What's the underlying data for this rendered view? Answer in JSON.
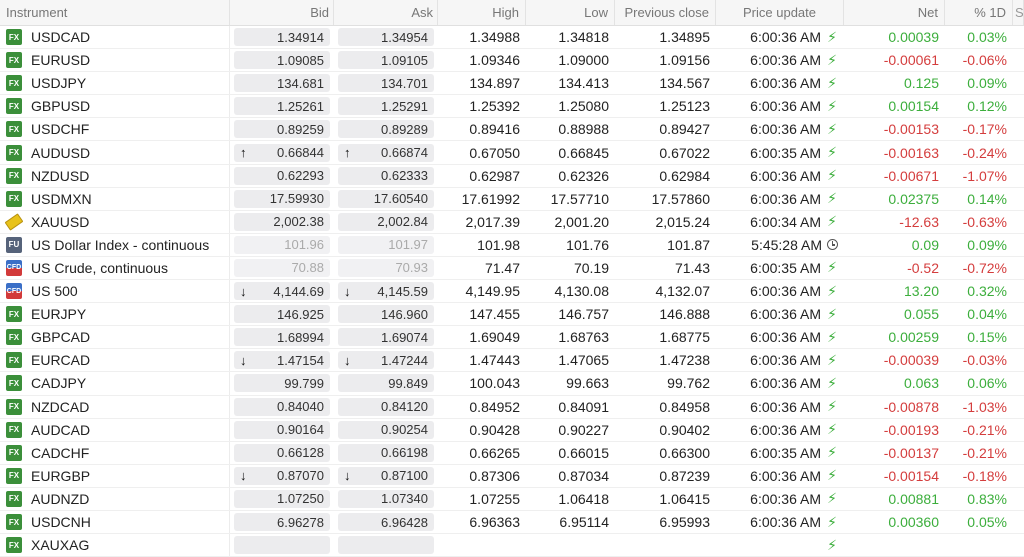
{
  "headers": {
    "instrument": "Instrument",
    "bid": "Bid",
    "ask": "Ask",
    "high": "High",
    "low": "Low",
    "previous_close": "Previous close",
    "price_update": "Price update",
    "net": "Net",
    "pct_1d": "% 1D",
    "extra": "S"
  },
  "colors": {
    "positive": "#3cae3c",
    "negative": "#d43d3d",
    "fx_badge": "#3b8f3a"
  },
  "rows": [
    {
      "badge": "FX",
      "name": "USDCAD",
      "bid": "1.34914",
      "ask": "1.34954",
      "high": "1.34988",
      "low": "1.34818",
      "prev": "1.34895",
      "time": "6:00:36 AM",
      "status": "lightning-icon",
      "net": "0.00039",
      "pct": "0.03%",
      "sign": "pos",
      "arrow": "",
      "dim": false
    },
    {
      "badge": "FX",
      "name": "EURUSD",
      "bid": "1.09085",
      "ask": "1.09105",
      "high": "1.09346",
      "low": "1.09000",
      "prev": "1.09156",
      "time": "6:00:36 AM",
      "status": "lightning-icon",
      "net": "-0.00061",
      "pct": "-0.06%",
      "sign": "neg",
      "arrow": "",
      "dim": false
    },
    {
      "badge": "FX",
      "name": "USDJPY",
      "bid": "134.681",
      "ask": "134.701",
      "high": "134.897",
      "low": "134.413",
      "prev": "134.567",
      "time": "6:00:36 AM",
      "status": "lightning-icon",
      "net": "0.125",
      "pct": "0.09%",
      "sign": "pos",
      "arrow": "",
      "dim": false
    },
    {
      "badge": "FX",
      "name": "GBPUSD",
      "bid": "1.25261",
      "ask": "1.25291",
      "high": "1.25392",
      "low": "1.25080",
      "prev": "1.25123",
      "time": "6:00:36 AM",
      "status": "lightning-icon",
      "net": "0.00154",
      "pct": "0.12%",
      "sign": "pos",
      "arrow": "",
      "dim": false
    },
    {
      "badge": "FX",
      "name": "USDCHF",
      "bid": "0.89259",
      "ask": "0.89289",
      "high": "0.89416",
      "low": "0.88988",
      "prev": "0.89427",
      "time": "6:00:36 AM",
      "status": "lightning-icon",
      "net": "-0.00153",
      "pct": "-0.17%",
      "sign": "neg",
      "arrow": "",
      "dim": false
    },
    {
      "badge": "FX",
      "name": "AUDUSD",
      "bid": "0.66844",
      "ask": "0.66874",
      "high": "0.67050",
      "low": "0.66845",
      "prev": "0.67022",
      "time": "6:00:35 AM",
      "status": "lightning-icon",
      "net": "-0.00163",
      "pct": "-0.24%",
      "sign": "neg",
      "arrow": "up",
      "dim": false
    },
    {
      "badge": "FX",
      "name": "NZDUSD",
      "bid": "0.62293",
      "ask": "0.62333",
      "high": "0.62987",
      "low": "0.62326",
      "prev": "0.62984",
      "time": "6:00:36 AM",
      "status": "lightning-icon",
      "net": "-0.00671",
      "pct": "-1.07%",
      "sign": "neg",
      "arrow": "",
      "dim": false
    },
    {
      "badge": "FX",
      "name": "USDMXN",
      "bid": "17.59930",
      "ask": "17.60540",
      "high": "17.61992",
      "low": "17.57710",
      "prev": "17.57860",
      "time": "6:00:36 AM",
      "status": "lightning-icon",
      "net": "0.02375",
      "pct": "0.14%",
      "sign": "pos",
      "arrow": "",
      "dim": false
    },
    {
      "badge": "GOLD",
      "name": "XAUUSD",
      "bid": "2,002.38",
      "ask": "2,002.84",
      "high": "2,017.39",
      "low": "2,001.20",
      "prev": "2,015.24",
      "time": "6:00:34 AM",
      "status": "lightning-icon",
      "net": "-12.63",
      "pct": "-0.63%",
      "sign": "neg",
      "arrow": "",
      "dim": false
    },
    {
      "badge": "FU",
      "name": "US Dollar Index - continuous",
      "bid": "101.96",
      "ask": "101.97",
      "high": "101.98",
      "low": "101.76",
      "prev": "101.87",
      "time": "5:45:28 AM",
      "status": "clock-icon",
      "net": "0.09",
      "pct": "0.09%",
      "sign": "pos",
      "arrow": "",
      "dim": true
    },
    {
      "badge": "CFD",
      "name": "US Crude, continuous",
      "bid": "70.88",
      "ask": "70.93",
      "high": "71.47",
      "low": "70.19",
      "prev": "71.43",
      "time": "6:00:35 AM",
      "status": "lightning-icon",
      "net": "-0.52",
      "pct": "-0.72%",
      "sign": "neg",
      "arrow": "",
      "dim": true
    },
    {
      "badge": "CFD",
      "name": "US 500",
      "bid": "4,144.69",
      "ask": "4,145.59",
      "high": "4,149.95",
      "low": "4,130.08",
      "prev": "4,132.07",
      "time": "6:00:36 AM",
      "status": "lightning-icon",
      "net": "13.20",
      "pct": "0.32%",
      "sign": "pos",
      "arrow": "down",
      "dim": false
    },
    {
      "badge": "FX",
      "name": "EURJPY",
      "bid": "146.925",
      "ask": "146.960",
      "high": "147.455",
      "low": "146.757",
      "prev": "146.888",
      "time": "6:00:36 AM",
      "status": "lightning-icon",
      "net": "0.055",
      "pct": "0.04%",
      "sign": "pos",
      "arrow": "",
      "dim": false
    },
    {
      "badge": "FX",
      "name": "GBPCAD",
      "bid": "1.68994",
      "ask": "1.69074",
      "high": "1.69049",
      "low": "1.68763",
      "prev": "1.68775",
      "time": "6:00:36 AM",
      "status": "lightning-icon",
      "net": "0.00259",
      "pct": "0.15%",
      "sign": "pos",
      "arrow": "",
      "dim": false
    },
    {
      "badge": "FX",
      "name": "EURCAD",
      "bid": "1.47154",
      "ask": "1.47244",
      "high": "1.47443",
      "low": "1.47065",
      "prev": "1.47238",
      "time": "6:00:36 AM",
      "status": "lightning-icon",
      "net": "-0.00039",
      "pct": "-0.03%",
      "sign": "neg",
      "arrow": "down",
      "dim": false
    },
    {
      "badge": "FX",
      "name": "CADJPY",
      "bid": "99.799",
      "ask": "99.849",
      "high": "100.043",
      "low": "99.663",
      "prev": "99.762",
      "time": "6:00:36 AM",
      "status": "lightning-icon",
      "net": "0.063",
      "pct": "0.06%",
      "sign": "pos",
      "arrow": "",
      "dim": false
    },
    {
      "badge": "FX",
      "name": "NZDCAD",
      "bid": "0.84040",
      "ask": "0.84120",
      "high": "0.84952",
      "low": "0.84091",
      "prev": "0.84958",
      "time": "6:00:36 AM",
      "status": "lightning-icon",
      "net": "-0.00878",
      "pct": "-1.03%",
      "sign": "neg",
      "arrow": "",
      "dim": false
    },
    {
      "badge": "FX",
      "name": "AUDCAD",
      "bid": "0.90164",
      "ask": "0.90254",
      "high": "0.90428",
      "low": "0.90227",
      "prev": "0.90402",
      "time": "6:00:36 AM",
      "status": "lightning-icon",
      "net": "-0.00193",
      "pct": "-0.21%",
      "sign": "neg",
      "arrow": "",
      "dim": false
    },
    {
      "badge": "FX",
      "name": "CADCHF",
      "bid": "0.66128",
      "ask": "0.66198",
      "high": "0.66265",
      "low": "0.66015",
      "prev": "0.66300",
      "time": "6:00:35 AM",
      "status": "lightning-icon",
      "net": "-0.00137",
      "pct": "-0.21%",
      "sign": "neg",
      "arrow": "",
      "dim": false
    },
    {
      "badge": "FX",
      "name": "EURGBP",
      "bid": "0.87070",
      "ask": "0.87100",
      "high": "0.87306",
      "low": "0.87034",
      "prev": "0.87239",
      "time": "6:00:36 AM",
      "status": "lightning-icon",
      "net": "-0.00154",
      "pct": "-0.18%",
      "sign": "neg",
      "arrow": "down",
      "dim": false
    },
    {
      "badge": "FX",
      "name": "AUDNZD",
      "bid": "1.07250",
      "ask": "1.07340",
      "high": "1.07255",
      "low": "1.06418",
      "prev": "1.06415",
      "time": "6:00:36 AM",
      "status": "lightning-icon",
      "net": "0.00881",
      "pct": "0.83%",
      "sign": "pos",
      "arrow": "",
      "dim": false
    },
    {
      "badge": "FX",
      "name": "USDCNH",
      "bid": "6.96278",
      "ask": "6.96428",
      "high": "6.96363",
      "low": "6.95114",
      "prev": "6.95993",
      "time": "6:00:36 AM",
      "status": "lightning-icon",
      "net": "0.00360",
      "pct": "0.05%",
      "sign": "pos",
      "arrow": "",
      "dim": false
    },
    {
      "badge": "FX",
      "name": "XAUXAG",
      "bid": "",
      "ask": "",
      "high": "",
      "low": "",
      "prev": "",
      "time": "",
      "status": "lightning-icon",
      "net": "",
      "pct": "",
      "sign": "pos",
      "arrow": "",
      "dim": false
    }
  ]
}
